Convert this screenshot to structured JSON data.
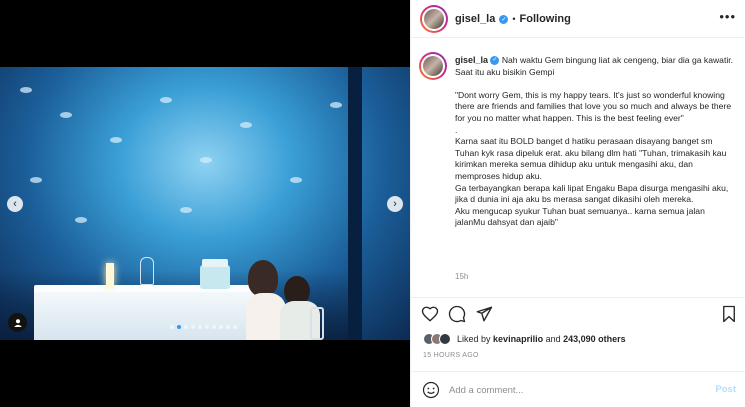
{
  "post": {
    "username": "gisel_la",
    "follow_separator": "•",
    "follow_status": "Following",
    "more_label": "•••",
    "caption_text": "Nah waktu Gem bingung liat ak cengeng, biar dia ga kawatir.\nSaat itu aku bisikin Gempi\n\n\"Dont worry Gem, this is my happy tears. It's just so wonderful knowing there are friends and families that love you so much and always be there for you no matter what happen. This is the best feeling ever\"\n.\nKarna saat itu BOLD banget d hatiku perasaan disayang banget sm Tuhan kyk rasa dipeluk erat. aku bilang dlm hati \"Tuhan, trimakasih kau kirimkan mereka semua dihidup aku untuk mengasihi aku, dan memproses hidup aku.\nGa terbayangkan berapa kali lipat Engaku Bapa disurga mengasihi aku, jika d dunia ini aja aku bs merasa sangat dikasihi oleh mereka.\nAku mengucap syukur Tuhan buat semuanya.. karna semua jalan jalanMu dahsyat dan ajaib\"",
    "caption_time": "15h",
    "liked_by_prefix": "Liked by",
    "liked_by_user": "kevinaprilio",
    "liked_by_and": "and",
    "likes_count": "243,090 others",
    "time_ago": "15 HOURS AGO",
    "comment_placeholder": "Add a comment...",
    "post_button": "Post"
  },
  "carousel": {
    "total_slides": 10,
    "active_index": 1
  },
  "icons": {
    "prev": "chevron-left-icon",
    "next": "chevron-right-icon",
    "tag": "user-tag-icon",
    "like": "heart-icon",
    "comment": "comment-icon",
    "share": "share-icon",
    "save": "bookmark-icon",
    "emoji": "emoji-icon",
    "verified": "verified-badge-icon"
  },
  "colors": {
    "accent": "#3897f0",
    "post_button_disabled": "#b2dffc",
    "muted_text": "#8e8e8e"
  }
}
